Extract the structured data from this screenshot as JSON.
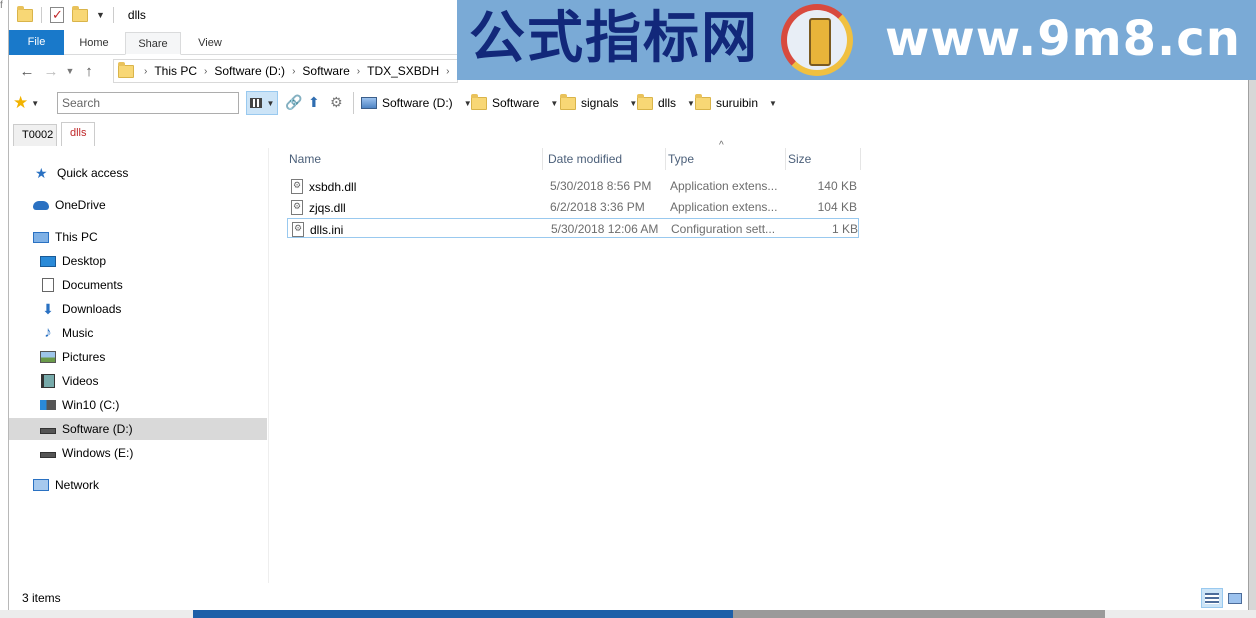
{
  "window": {
    "title": "dlls"
  },
  "ribbon": {
    "tabs": [
      "File",
      "Home",
      "Share",
      "View"
    ]
  },
  "address": {
    "crumbs": [
      "This PC",
      "Software (D:)",
      "Software",
      "TDX_SXBDH"
    ]
  },
  "watermark": {
    "cn_text": "公式指标网",
    "url_text": "www.9m8.cn"
  },
  "toolbar2": {
    "search_placeholder": "Search",
    "breadcrumbs": [
      "Software (D:)",
      "Software",
      "signals",
      "dlls",
      "suruibin"
    ]
  },
  "folder_tabs": [
    "T0002",
    "dlls"
  ],
  "nav": {
    "items": [
      {
        "label": "Quick access",
        "icon": "star-icon"
      },
      {
        "label": "OneDrive",
        "icon": "cloud-icon"
      },
      {
        "label": "This PC",
        "icon": "computer-icon"
      },
      {
        "label": "Desktop",
        "icon": "desktop-icon"
      },
      {
        "label": "Documents",
        "icon": "documents-icon"
      },
      {
        "label": "Downloads",
        "icon": "download-icon"
      },
      {
        "label": "Music",
        "icon": "music-icon"
      },
      {
        "label": "Pictures",
        "icon": "pictures-icon"
      },
      {
        "label": "Videos",
        "icon": "videos-icon"
      },
      {
        "label": "Win10 (C:)",
        "icon": "windows-drive-icon"
      },
      {
        "label": "Software (D:)",
        "icon": "drive-icon"
      },
      {
        "label": "Windows (E:)",
        "icon": "drive-icon"
      },
      {
        "label": "Network",
        "icon": "network-icon"
      }
    ]
  },
  "files": {
    "columns": [
      "Name",
      "Date modified",
      "Type",
      "Size"
    ],
    "rows": [
      {
        "name": "xsbdh.dll",
        "date": "5/30/2018 8:56 PM",
        "type": "Application extens...",
        "size": "140 KB"
      },
      {
        "name": "zjqs.dll",
        "date": "6/2/2018 3:36 PM",
        "type": "Application extens...",
        "size": "104 KB"
      },
      {
        "name": "dlls.ini",
        "date": "5/30/2018 12:06 AM",
        "type": "Configuration sett...",
        "size": "1 KB"
      }
    ]
  },
  "status": {
    "count": "3 items"
  },
  "colors": {
    "accent": "#1979ca",
    "selection": "#cce4f7",
    "watermark_bg": "#7aaad6",
    "watermark_text": "#12287a"
  }
}
